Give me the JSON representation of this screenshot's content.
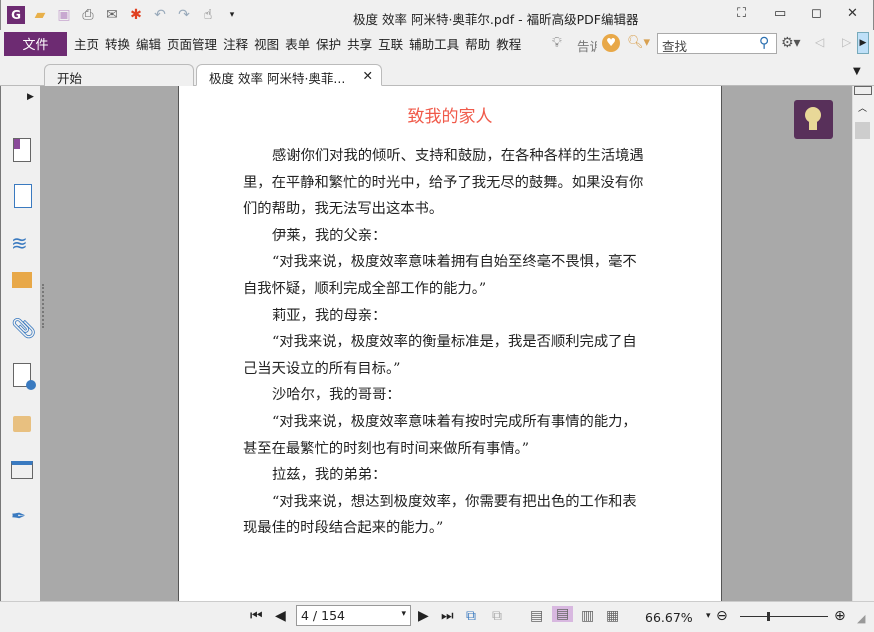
{
  "window": {
    "title": "极度 效率 阿米特·奥菲尔.pdf - 福昕高级PDF编辑器"
  },
  "menu": {
    "file": "文件",
    "items": [
      "主页",
      "转换",
      "编辑",
      "页面管理",
      "注释",
      "视图",
      "表单",
      "保护",
      "共享",
      "互联",
      "辅助工具",
      "帮助",
      "教程"
    ],
    "tell": "告诉",
    "search_placeholder": "查找"
  },
  "tabs": [
    {
      "label": "开始"
    },
    {
      "label": "极度 效率 阿米特·奥菲..."
    }
  ],
  "document": {
    "title": "致我的家人",
    "lines": [
      {
        "text": "感谢你们对我的倾听、支持和鼓励，在各种各样的生活境遇",
        "indent": true
      },
      {
        "text": "里，在平静和繁忙的时光中，给予了我无尽的鼓舞。如果没有你",
        "indent": false
      },
      {
        "text": "们的帮助，我无法写出这本书。",
        "indent": false
      },
      {
        "text": "伊莱，我的父亲：",
        "indent": true
      },
      {
        "text": "“对我来说，极度效率意味着拥有自始至终毫不畏惧，毫不",
        "indent": true
      },
      {
        "text": "自我怀疑，顺利完成全部工作的能力。”",
        "indent": false
      },
      {
        "text": "莉亚，我的母亲：",
        "indent": true
      },
      {
        "text": "“对我来说，极度效率的衡量标准是，我是否顺利完成了自",
        "indent": true
      },
      {
        "text": "己当天设立的所有目标。”",
        "indent": false
      },
      {
        "text": "沙哈尔，我的哥哥：",
        "indent": true
      },
      {
        "text": "“对我来说，极度效率意味着有按时完成所有事情的能力，",
        "indent": true
      },
      {
        "text": "甚至在最繁忙的时刻也有时间来做所有事情。”",
        "indent": false
      },
      {
        "text": "拉兹，我的弟弟：",
        "indent": true
      },
      {
        "text": "“对我来说，想达到极度效率，你需要有把出色的工作和表",
        "indent": true
      },
      {
        "text": "现最佳的时段结合起来的能力。”",
        "indent": false
      }
    ]
  },
  "status": {
    "page": "4 / 154",
    "zoom": "66.67%"
  },
  "colors": {
    "accent": "#6d2b72",
    "title": "#f05a4a",
    "viewer_bg": "#a9a9a9"
  }
}
